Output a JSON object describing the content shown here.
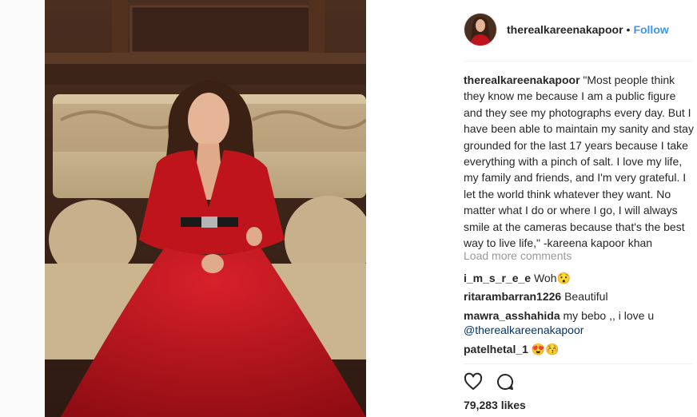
{
  "post": {
    "username": "therealkareenakapoor",
    "dot": "•",
    "follow_label": "Follow",
    "caption_user": "therealkareenakapoor",
    "caption_text": " \"Most people think they know me because I am a public figure and they see my photographs every day. But I have been able to maintain my sanity and stay grounded for the last 17 years because I take everything with a pinch of salt. I love my life, my family and friends, and I'm very grateful. I let the world think whatever they want. No matter what I do or where I go, I will always smile at the cameras because that's the best way to live life,\" -kareena kapoor khan",
    "load_more": "Load more comments",
    "comments": [
      {
        "user": "i_m_s_r_e_e",
        "text": " Woh😯"
      },
      {
        "user": "ritarambarran1226",
        "text": " Beautiful"
      },
      {
        "user": "mawra_asshahida",
        "text": " my bebo ,, i love u ",
        "mention": "@therealkareenakapoor"
      },
      {
        "user": "patelhetal_1",
        "text": " 😍😚"
      }
    ],
    "likes": "79,283 likes"
  },
  "icons": {
    "like": "heart-icon",
    "comment": "comment-bubble-icon"
  },
  "colors": {
    "follow": "#3897f0",
    "mention": "#003569",
    "muted": "#999999",
    "dress": "#c0141c"
  }
}
